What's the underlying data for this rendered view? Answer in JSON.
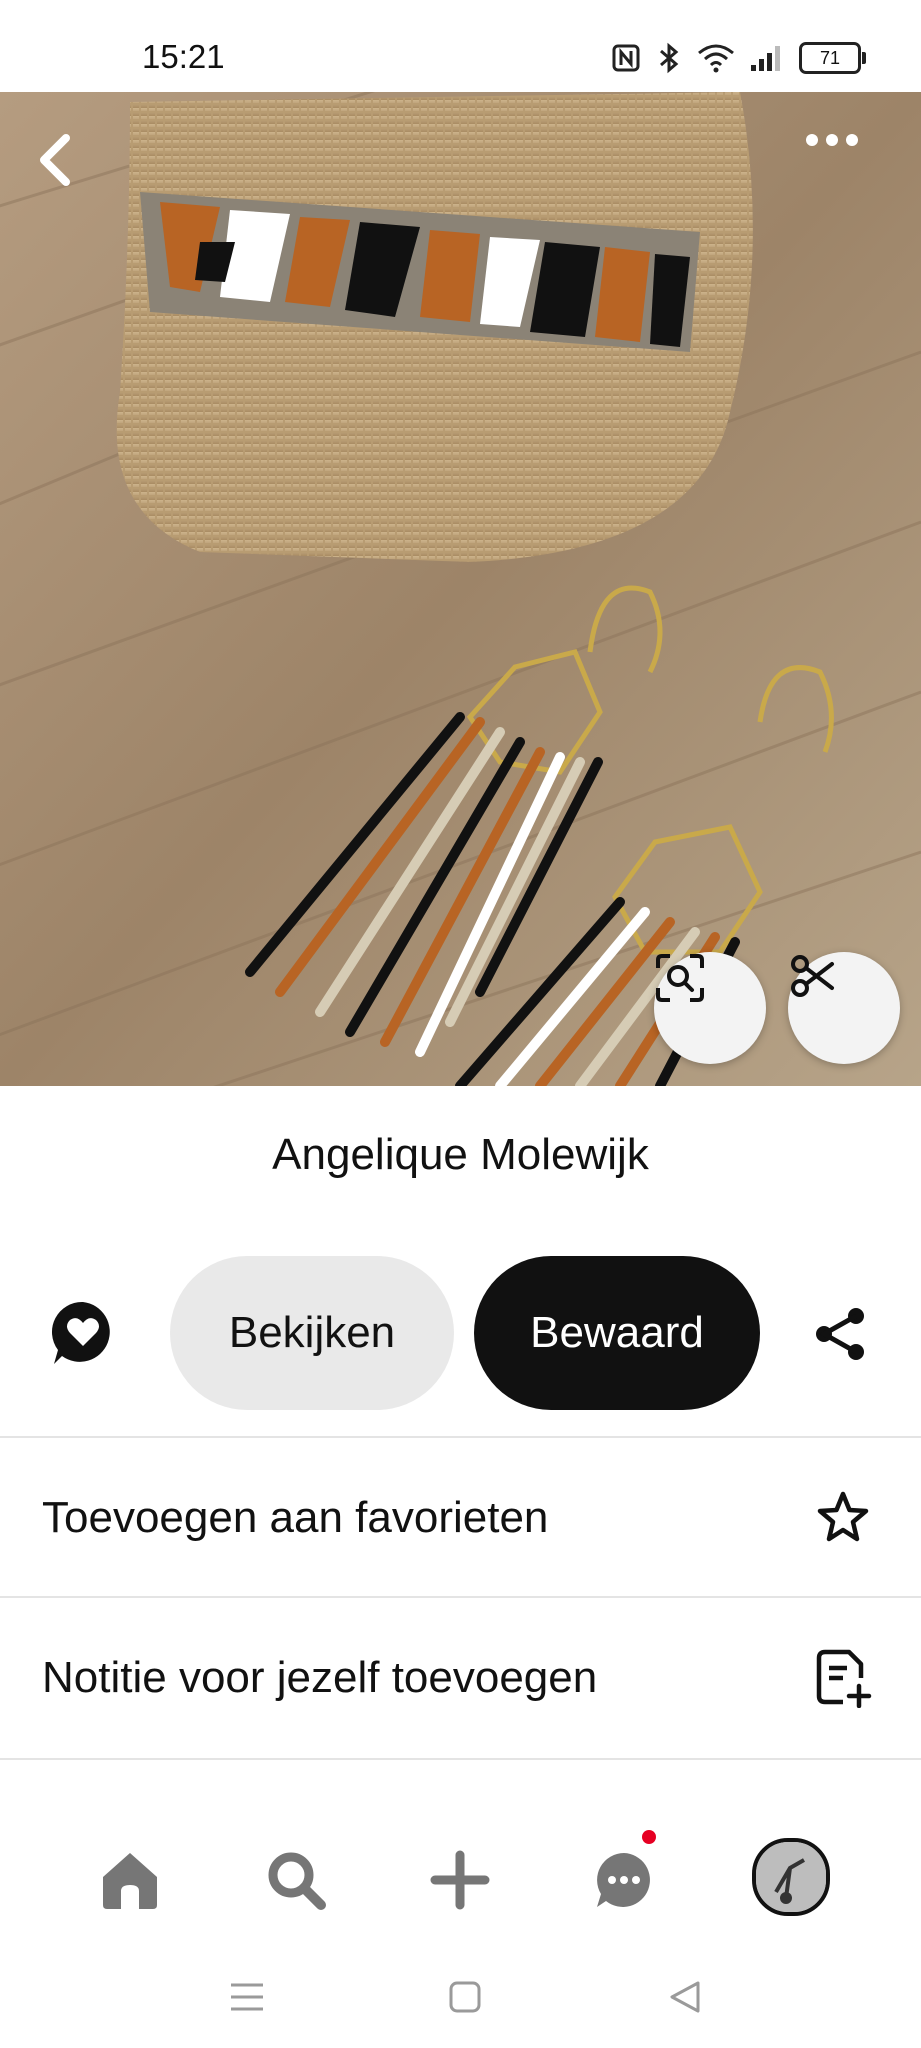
{
  "status_bar": {
    "time": "15:21",
    "battery_level": "71",
    "icons": [
      "nfc-icon",
      "bluetooth-icon",
      "wifi-icon",
      "signal-icon",
      "battery-icon"
    ]
  },
  "pin": {
    "image_description_icon_names": [
      "back-arrow-icon",
      "more-options-icon",
      "visual-search-icon",
      "scissors-icon"
    ],
    "author": "Angelique Molewijk"
  },
  "actions": {
    "view_label": "Bekijken",
    "saved_label": "Bewaard"
  },
  "menu": {
    "favorites_label": "Toevoegen aan favorieten",
    "note_label": "Notitie voor jezelf toevoegen"
  },
  "bottom_nav": {
    "items": [
      "home-icon",
      "search-icon",
      "create-icon",
      "messages-icon",
      "profile-avatar"
    ],
    "has_notification": true
  },
  "colors": {
    "accent_dark": "#111111",
    "pill_light": "#e9e9e9",
    "notification": "#e60023"
  }
}
